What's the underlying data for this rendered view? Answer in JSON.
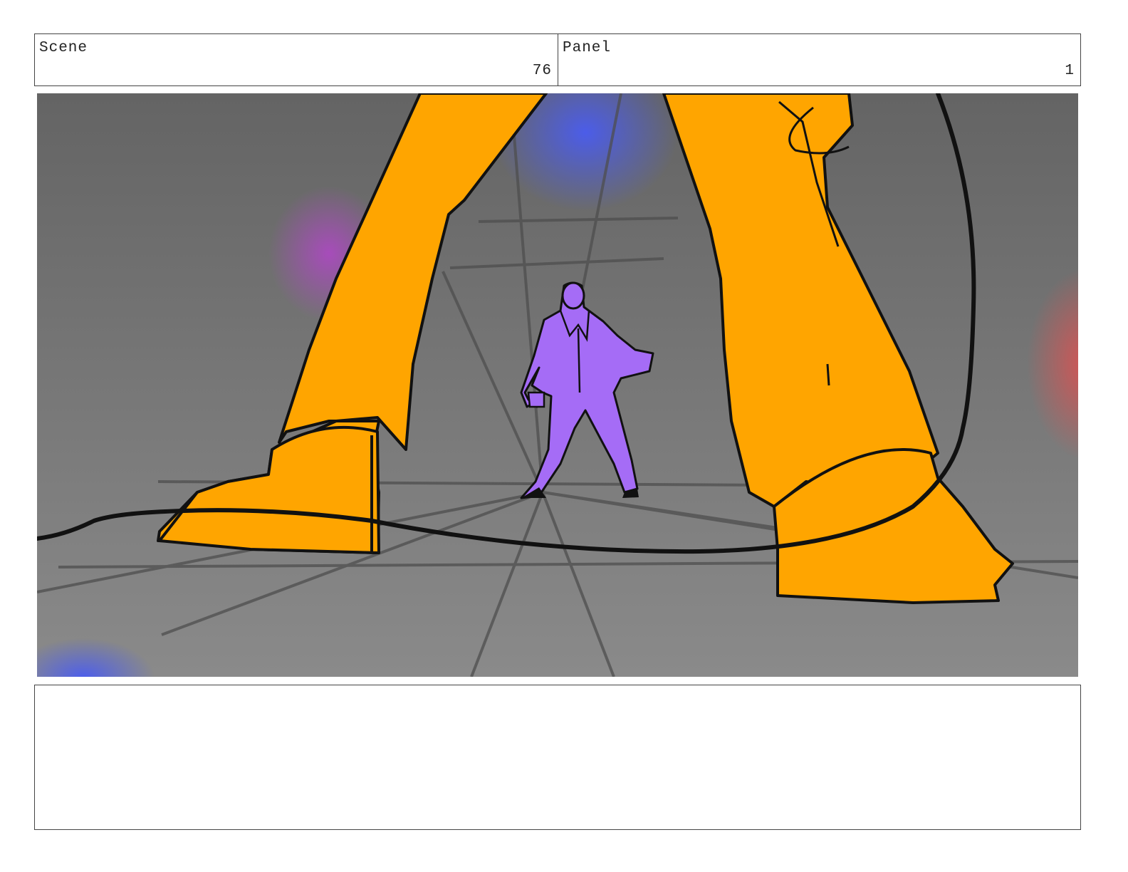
{
  "header": {
    "scene_label": "Scene",
    "scene_value": "76",
    "panel_label": "Panel",
    "panel_value": "1"
  },
  "frame": {
    "content": "storyboard-sketch",
    "colors": {
      "background_top": "#646464",
      "background_bottom": "#8a8a8a",
      "giant_legs": "#ffa500",
      "small_figure": "#a56cf6",
      "outline": "#111111",
      "spot_blue": "#4a5cf0",
      "spot_magenta": "#b146c8",
      "spot_red": "#e05050"
    }
  },
  "notes": {
    "text": ""
  }
}
